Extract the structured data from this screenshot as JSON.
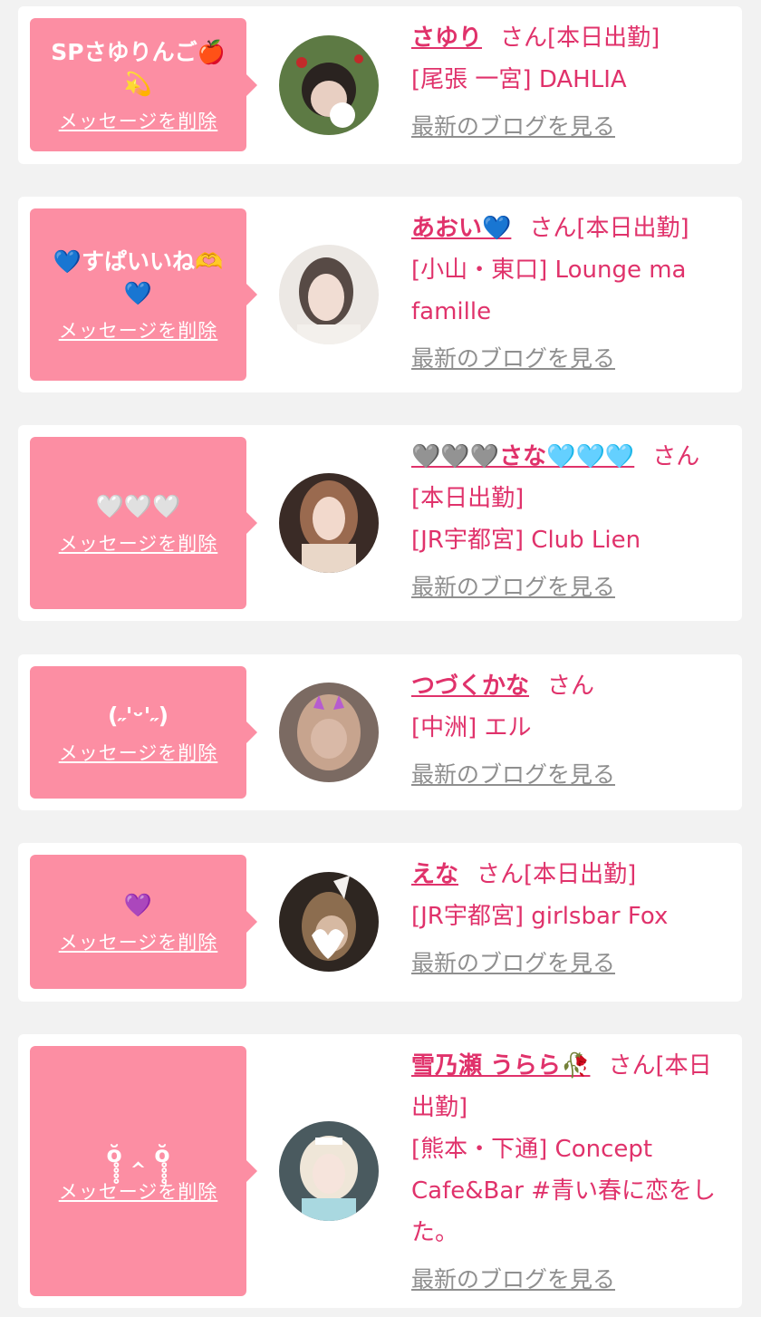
{
  "common": {
    "delete_label": "メッセージを削除",
    "blog_label": "最新のブログを見る",
    "san": "さん",
    "colors": {
      "bubble": "#fc8ea3",
      "accent": "#e0326b",
      "link_gray": "#8f8f8f",
      "bg": "#f2f2f2"
    }
  },
  "items": [
    {
      "message": "SPさゆりんご🍎💫",
      "name": "さゆり",
      "status": "[本日出勤]",
      "shop": "[尾張 一宮] DAHLIA"
    },
    {
      "message": "💙すぱいいね🫶💙",
      "name": "あおい💙",
      "status": "[本日出勤]",
      "shop": "[小山・東口] Lounge ma famille"
    },
    {
      "message": "🤍🤍🤍",
      "name": "🩶🩶🩶さな🩵🩵🩵",
      "status": "[本日出勤]",
      "shop": "[JR宇都宮] Club Lien"
    },
    {
      "message": "(˶'ᵕ'˶)",
      "name": "つづくかな",
      "status": "",
      "shop": "[中洲] エル"
    },
    {
      "message": "💜",
      "name": "えな",
      "status": "[本日出勤]",
      "shop": "[JR宇都宮] girlsbar Fox"
    },
    {
      "message": "ŏ̥̥̥̥ ‸ ŏ̥̥̥̥",
      "name": "雪乃瀬 うらら🥀",
      "status": "[本日出勤]",
      "shop": "[熊本・下通] Concept Cafe&Bar #青い春に恋をした。"
    }
  ]
}
